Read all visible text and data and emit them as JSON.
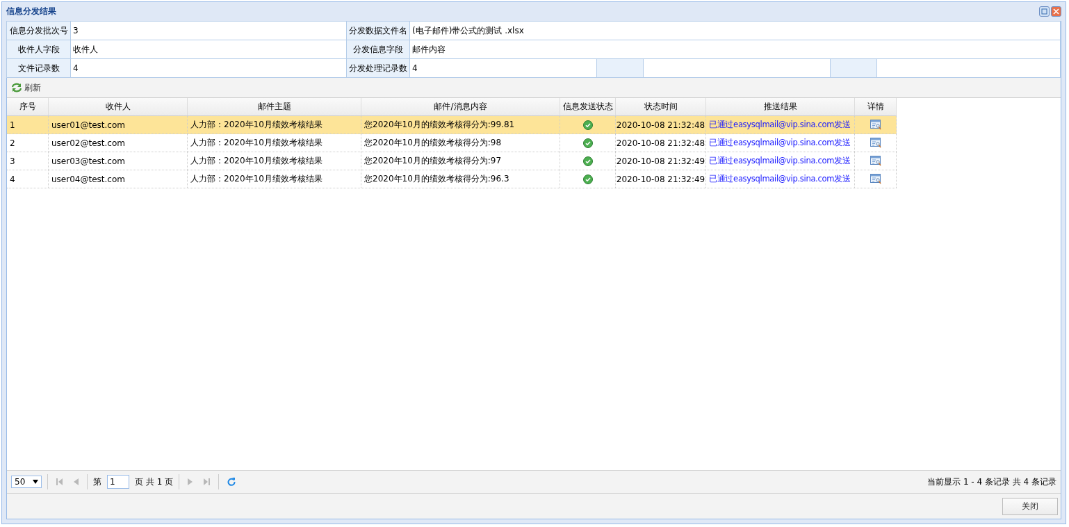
{
  "window": {
    "title": "信息分发结果"
  },
  "info": [
    {
      "label": "信息分发批次号",
      "value": "3"
    },
    {
      "label": "分发数据文件名",
      "value": "(电子邮件)带公式的测试 .xlsx"
    },
    {
      "label": "收件人字段",
      "value": "收件人"
    },
    {
      "label": "分发信息字段",
      "value": "邮件内容"
    },
    {
      "label": "文件记录数",
      "value": "4"
    },
    {
      "label": "分发处理记录数",
      "value": "4"
    }
  ],
  "toolbar": {
    "refresh": "刷新"
  },
  "table": {
    "columns": [
      "序号",
      "收件人",
      "邮件主题",
      "邮件/消息内容",
      "信息发送状态",
      "状态时间",
      "推送结果",
      "详情"
    ],
    "rows": [
      {
        "no": "1",
        "recipient": "user01@test.com",
        "subject": "人力部：2020年10月绩效考核结果",
        "content": "您2020年10月的绩效考核得分为:99.81",
        "sent": true,
        "time": "2020-10-08 21:32:48",
        "result": "已通过easysqlmail@vip.sina.com发送",
        "selected": true
      },
      {
        "no": "2",
        "recipient": "user02@test.com",
        "subject": "人力部：2020年10月绩效考核结果",
        "content": "您2020年10月的绩效考核得分为:98",
        "sent": true,
        "time": "2020-10-08 21:32:48",
        "result": "已通过easysqlmail@vip.sina.com发送",
        "selected": false
      },
      {
        "no": "3",
        "recipient": "user03@test.com",
        "subject": "人力部：2020年10月绩效考核结果",
        "content": "您2020年10月的绩效考核得分为:97",
        "sent": true,
        "time": "2020-10-08 21:32:49",
        "result": "已通过easysqlmail@vip.sina.com发送",
        "selected": false
      },
      {
        "no": "4",
        "recipient": "user04@test.com",
        "subject": "人力部：2020年10月绩效考核结果",
        "content": "您2020年10月的绩效考核得分为:96.3",
        "sent": true,
        "time": "2020-10-08 21:32:49",
        "result": "已通过easysqlmail@vip.sina.com发送",
        "selected": false
      }
    ]
  },
  "pager": {
    "page_size": "50",
    "page_prefix": "第",
    "page": "1",
    "page_suffix": "页 共 1 页",
    "nav_disabled": true,
    "summary": "当前显示 1 - 4 条记录 共 4 条记录"
  },
  "buttons": [
    "关闭"
  ]
}
